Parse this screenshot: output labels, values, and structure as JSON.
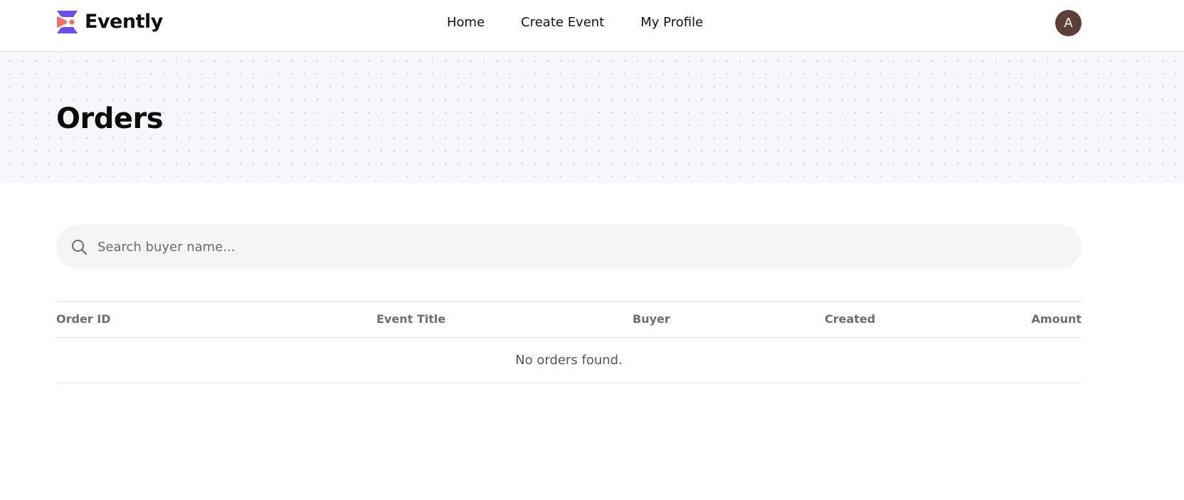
{
  "app": {
    "brand": "Evently",
    "colors": {
      "logo_top": "#6c4cf2",
      "logo_bottom": "#f26f6f",
      "avatar_bg": "#5c3f36",
      "hero_bg": "#f6f7fc",
      "search_bg": "#f5f5f5"
    }
  },
  "nav": {
    "items": [
      {
        "label": "Home"
      },
      {
        "label": "Create Event"
      },
      {
        "label": "My Profile"
      }
    ]
  },
  "user": {
    "avatar_initial": "A"
  },
  "page": {
    "title": "Orders"
  },
  "search": {
    "value": "",
    "placeholder": "Search buyer name...",
    "icon": "search-icon"
  },
  "table": {
    "columns": [
      "Order ID",
      "Event Title",
      "Buyer",
      "Created",
      "Amount"
    ],
    "rows": [],
    "empty_message": "No orders found."
  }
}
